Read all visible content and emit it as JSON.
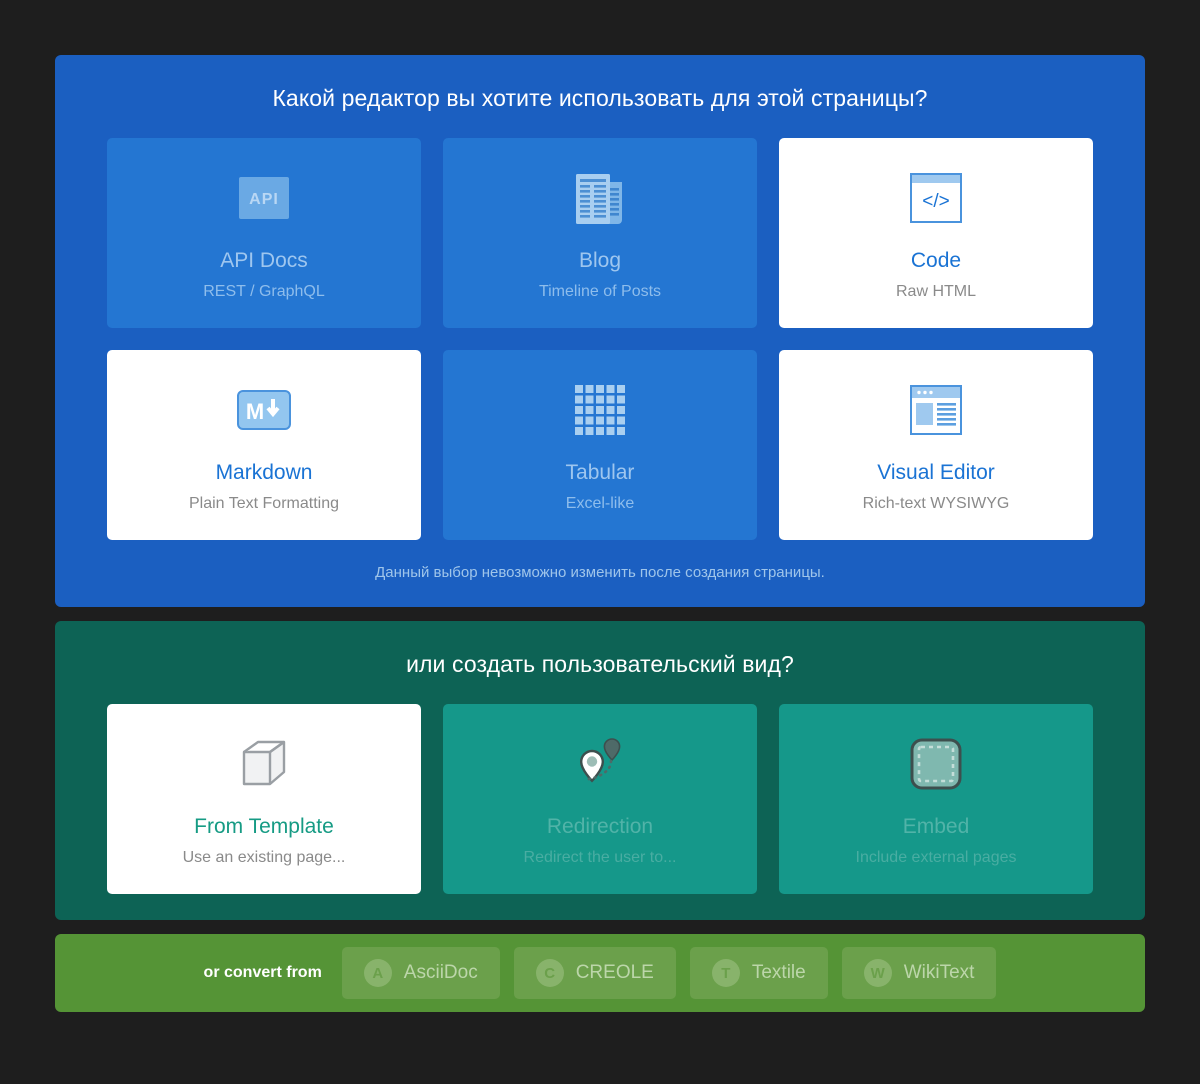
{
  "editors_panel": {
    "title": "Какой редактор вы хотите использовать для этой страницы?",
    "note": "Данный выбор невозможно изменить после создания страницы.",
    "accent_color": "#1b5fc1",
    "cards": [
      {
        "title": "API Docs",
        "subtitle": "REST / GraphQL",
        "icon": "api-badge-icon",
        "state": "idle"
      },
      {
        "title": "Blog",
        "subtitle": "Timeline of Posts",
        "icon": "newspaper-icon",
        "state": "idle"
      },
      {
        "title": "Code",
        "subtitle": "Raw HTML",
        "icon": "code-window-icon",
        "state": "active"
      },
      {
        "title": "Markdown",
        "subtitle": "Plain Text Formatting",
        "icon": "markdown-icon",
        "state": "active"
      },
      {
        "title": "Tabular",
        "subtitle": "Excel-like",
        "icon": "grid-table-icon",
        "state": "idle"
      },
      {
        "title": "Visual Editor",
        "subtitle": "Rich-text WYSIWYG",
        "icon": "browser-layout-icon",
        "state": "active"
      }
    ]
  },
  "custom_panel": {
    "title": "или создать пользовательский вид?",
    "accent_color": "#0d6355",
    "cards": [
      {
        "title": "From Template",
        "subtitle": "Use an existing page...",
        "icon": "cube-icon",
        "state": "active"
      },
      {
        "title": "Redirection",
        "subtitle": "Redirect the user to...",
        "icon": "map-pins-icon",
        "state": "idle"
      },
      {
        "title": "Embed",
        "subtitle": "Include external pages",
        "icon": "dashed-square-icon",
        "state": "idle"
      }
    ]
  },
  "convert_bar": {
    "label": "or convert from",
    "accent_color": "#559436",
    "chips": [
      {
        "label": "AsciiDoc",
        "badge": "A"
      },
      {
        "label": "CREOLE",
        "badge": "C"
      },
      {
        "label": "Textile",
        "badge": "T"
      },
      {
        "label": "WikiText",
        "badge": "W"
      }
    ]
  }
}
